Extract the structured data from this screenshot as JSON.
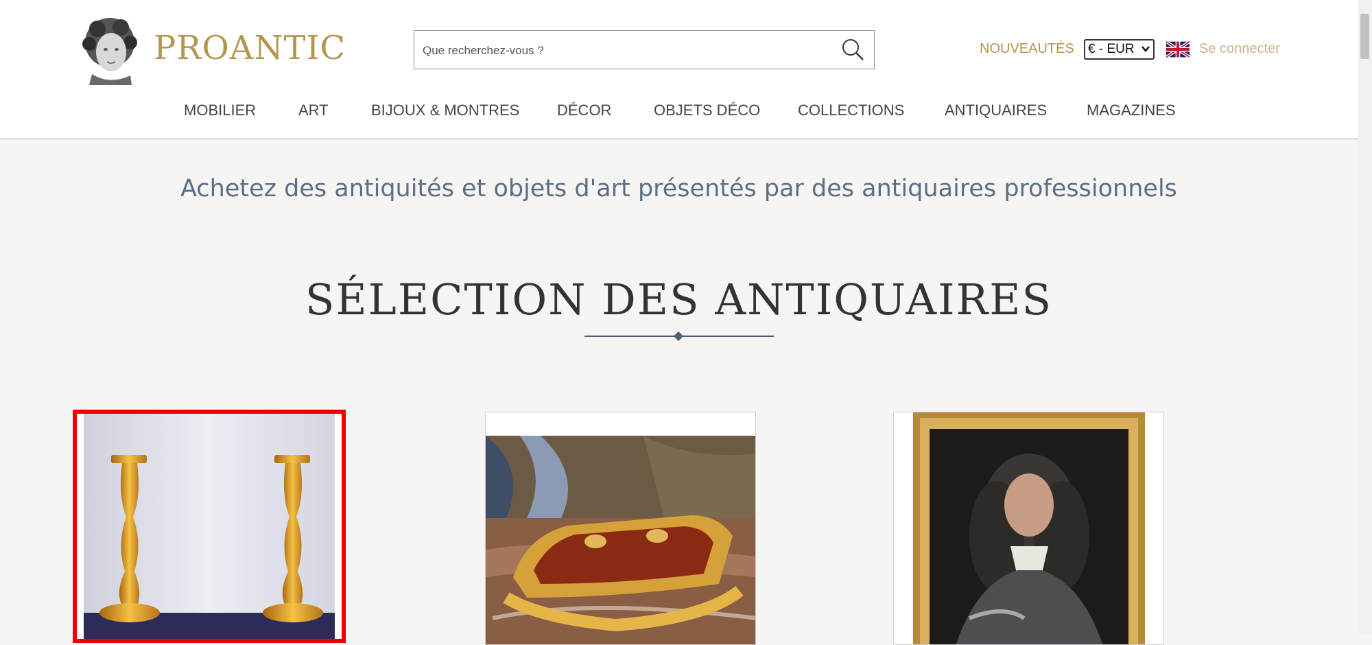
{
  "header": {
    "logo_text": "PROANTIC",
    "search_placeholder": "Que recherchez-vous ?",
    "new_label": "NOUVEAUTÉS",
    "currency_label": "€ - EUR",
    "login_label": "Se connecter"
  },
  "nav": {
    "items": [
      "MOBILIER",
      "ART",
      "BIJOUX & MONTRES",
      "DÉCOR",
      "OBJETS DÉCO",
      "COLLECTIONS",
      "ANTIQUAIRES",
      "MAGAZINES"
    ]
  },
  "main": {
    "tagline": "Achetez des antiquités et objets d'art présentés par des antiquaires professionnels",
    "section_title": "SÉLECTION DES ANTIQUAIRES"
  },
  "colors": {
    "brand_gold": "#b49552",
    "tagline_blue": "#5c6e86",
    "selection_red": "#ee0000"
  },
  "icons": [
    "logo-bust-icon",
    "search-icon",
    "uk-flag-icon",
    "chevron-down-icon"
  ]
}
